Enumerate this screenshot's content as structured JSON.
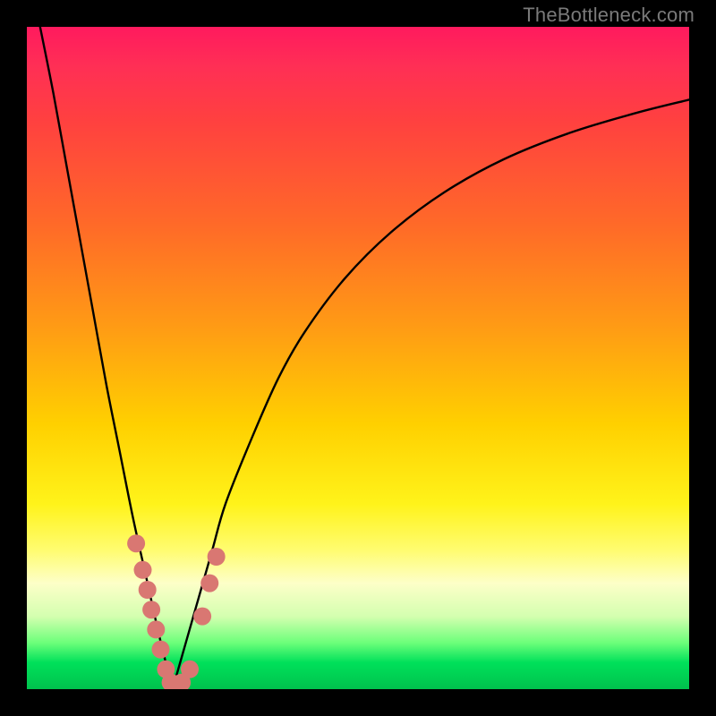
{
  "watermark": "TheBottleneck.com",
  "colors": {
    "frame": "#000000",
    "curve": "#000000",
    "marker_fill": "#d97772",
    "gradient_stops": [
      "#ff1a5e",
      "#ff4040",
      "#ff9a15",
      "#fff31a",
      "#fdffc8",
      "#00e05a"
    ]
  },
  "chart_data": {
    "type": "line",
    "title": "",
    "xlabel": "",
    "ylabel": "",
    "xlim": [
      0,
      100
    ],
    "ylim": [
      0,
      100
    ],
    "note": "V-shaped bottleneck curve; no axis ticks or numeric labels are rendered. Values are visual estimates of curve height as % of plot height; minimum at x≈22.",
    "series": [
      {
        "name": "left-branch",
        "x": [
          2,
          4,
          6,
          8,
          10,
          12,
          14,
          16,
          18,
          20,
          22
        ],
        "y": [
          100,
          90,
          79,
          68,
          57,
          46,
          36,
          26,
          17,
          8,
          0
        ]
      },
      {
        "name": "right-branch",
        "x": [
          22,
          24,
          26,
          28,
          30,
          34,
          38,
          42,
          48,
          55,
          63,
          72,
          82,
          92,
          100
        ],
        "y": [
          0,
          7,
          14,
          21,
          28,
          38,
          47,
          54,
          62,
          69,
          75,
          80,
          84,
          87,
          89
        ]
      }
    ],
    "markers": {
      "name": "highlighted-points",
      "note": "Salmon-colored dots clustered near the curve minimum on both branches.",
      "points": [
        {
          "x": 16.5,
          "y": 22
        },
        {
          "x": 17.5,
          "y": 18
        },
        {
          "x": 18.2,
          "y": 15
        },
        {
          "x": 18.8,
          "y": 12
        },
        {
          "x": 19.5,
          "y": 9
        },
        {
          "x": 20.2,
          "y": 6
        },
        {
          "x": 21.0,
          "y": 3
        },
        {
          "x": 21.7,
          "y": 1
        },
        {
          "x": 22.5,
          "y": 0.5
        },
        {
          "x": 23.4,
          "y": 1
        },
        {
          "x": 24.6,
          "y": 3
        },
        {
          "x": 26.5,
          "y": 11
        },
        {
          "x": 27.6,
          "y": 16
        },
        {
          "x": 28.6,
          "y": 20
        }
      ]
    }
  }
}
